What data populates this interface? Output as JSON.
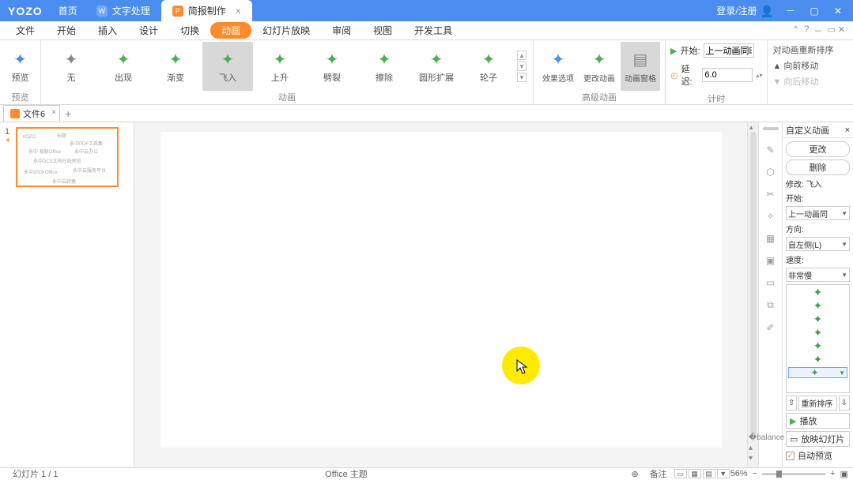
{
  "titlebar": {
    "logo": "YOZO",
    "home": "首页",
    "tabs": [
      {
        "label": "文字处理",
        "icon_color": "#6fa8ff"
      },
      {
        "label": "简报制作",
        "icon_color": "#ff8b2d",
        "active": true
      }
    ],
    "login": "登录/注册"
  },
  "menu": {
    "items": [
      "文件",
      "开始",
      "插入",
      "设计",
      "切换",
      "动画",
      "幻灯片放映",
      "审阅",
      "视图",
      "开发工具"
    ],
    "active_index": 5
  },
  "ribbon": {
    "preview_group": {
      "preview": "预览",
      "label": "预览"
    },
    "anim_group": {
      "items": [
        "无",
        "出现",
        "渐变",
        "飞入",
        "上升",
        "劈裂",
        "擦除",
        "圆形扩展",
        "轮子"
      ],
      "selected_index": 3,
      "label": "动画"
    },
    "adv_group": {
      "items": [
        "效果选项",
        "更改动画",
        "动画窗格"
      ],
      "label": "高级动画"
    },
    "timing": {
      "start_label": "开始:",
      "start_value": "上一动画同时",
      "delay_label": "延迟:",
      "delay_value": "6.0",
      "label": "计时"
    },
    "reorder": {
      "title": "对动画重新排序",
      "fwd": "向前移动",
      "back": "向后移动"
    }
  },
  "doctab": {
    "name": "文件6"
  },
  "thumb": {
    "num": "1"
  },
  "slide_content": {
    "lines": [
      "YOZO",
      "标题",
      "永中PDF工具集",
      "永中 易联Office",
      "永中云办公",
      "永中DCS文档在线预览",
      "永中云服务平台",
      "永中2019 Office",
      "永中云转换"
    ]
  },
  "anim_pane": {
    "title": "自定义动画",
    "change": "更改",
    "delete": "删除",
    "modify": "修改: 飞入",
    "start_label": "开始:",
    "start_value": "上一动画同",
    "dir_label": "方向:",
    "dir_value": "自左侧(L)",
    "speed_label": "速度:",
    "speed_value": "非常慢",
    "reorder": "重新排序",
    "play": "播放",
    "slideshow": "放映幻灯片",
    "autopreview": "自动预览"
  },
  "status": {
    "slide": "幻灯片 1 / 1",
    "theme": "Office 主题",
    "notes": "备注",
    "zoom": "56%"
  }
}
